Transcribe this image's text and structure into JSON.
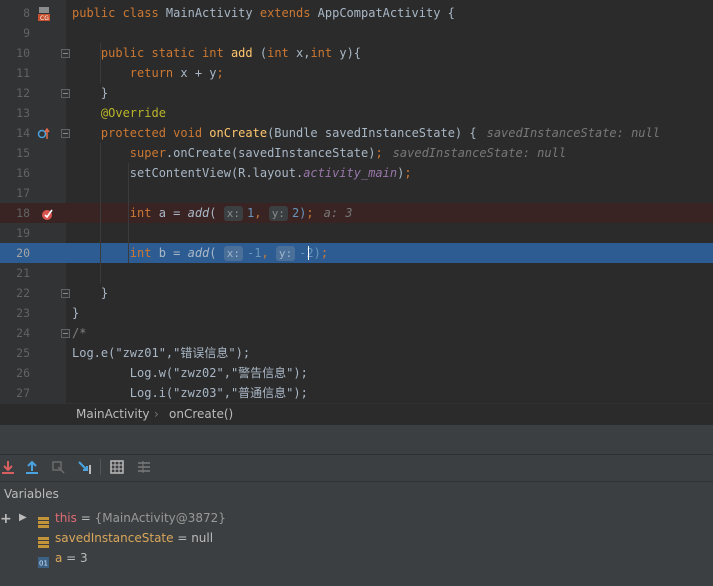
{
  "editor": {
    "lines": [
      {
        "num": "8",
        "tokens": [
          {
            "t": "public class ",
            "c": "kw"
          },
          {
            "t": "MainActivity ",
            "c": ""
          },
          {
            "t": "extends ",
            "c": "kw"
          },
          {
            "t": "AppCompatActivity {",
            "c": ""
          }
        ]
      },
      {
        "num": "9",
        "tokens": []
      },
      {
        "num": "10",
        "tokens": [
          {
            "t": "    public static int ",
            "c": "kw"
          },
          {
            "t": "add ",
            "c": "fn"
          },
          {
            "t": "(",
            "c": ""
          },
          {
            "t": "int ",
            "c": "kw"
          },
          {
            "t": "x,",
            "c": ""
          },
          {
            "t": "int ",
            "c": "kw"
          },
          {
            "t": "y){",
            "c": ""
          }
        ]
      },
      {
        "num": "11",
        "tokens": [
          {
            "t": "        return ",
            "c": "kw"
          },
          {
            "t": "x + y",
            "c": ""
          },
          {
            "t": ";",
            "c": "kw"
          }
        ]
      },
      {
        "num": "12",
        "tokens": [
          {
            "t": "    }",
            "c": ""
          }
        ]
      },
      {
        "num": "13",
        "tokens": [
          {
            "t": "    @Override",
            "c": "ann"
          }
        ]
      },
      {
        "num": "14",
        "tokens": [
          {
            "t": "    protected void ",
            "c": "kw"
          },
          {
            "t": "onCreate",
            "c": "fn"
          },
          {
            "t": "(Bundle savedInstanceState) {",
            "c": ""
          }
        ],
        "hint": "savedInstanceState: null"
      },
      {
        "num": "15",
        "tokens": [
          {
            "t": "        super",
            "c": "kw"
          },
          {
            "t": ".onCreate(savedInstanceState)",
            "c": ""
          },
          {
            "t": ";",
            "c": "kw"
          }
        ],
        "hint": "savedInstanceState: null"
      },
      {
        "num": "16",
        "tokens": [
          {
            "t": "        setContentView(R.layout.",
            "c": ""
          },
          {
            "t": "activity_main",
            "c": "fld"
          },
          {
            "t": ")",
            "c": ""
          },
          {
            "t": ";",
            "c": "kw"
          }
        ]
      },
      {
        "num": "17",
        "tokens": []
      },
      {
        "num": "18",
        "tokens": [
          {
            "t": "        int ",
            "c": "kw"
          },
          {
            "t": "a = ",
            "c": ""
          },
          {
            "t": "add",
            "c": "it"
          },
          {
            "t": "( ",
            "c": ""
          },
          {
            "t": "x:",
            "c": "ph"
          },
          {
            "t": "1",
            "c": "num"
          },
          {
            "t": ", ",
            "c": "kw"
          },
          {
            "t": "y:",
            "c": "ph"
          },
          {
            "t": "2)",
            "c": "num"
          },
          {
            "t": ";",
            "c": "kw"
          }
        ],
        "hint": "a: 3"
      },
      {
        "num": "19",
        "tokens": []
      },
      {
        "num": "20",
        "tokens": [
          {
            "t": "        int ",
            "c": "kw"
          },
          {
            "t": "b = ",
            "c": ""
          },
          {
            "t": "add",
            "c": "it"
          },
          {
            "t": "( ",
            "c": ""
          },
          {
            "t": "x:",
            "c": "ph"
          },
          {
            "t": "-1",
            "c": "num"
          },
          {
            "t": ", ",
            "c": "kw"
          },
          {
            "t": "y:",
            "c": "ph"
          },
          {
            "t": "-2)",
            "c": "num"
          },
          {
            "t": ";",
            "c": "kw"
          }
        ]
      },
      {
        "num": "21",
        "tokens": []
      },
      {
        "num": "22",
        "tokens": [
          {
            "t": "    }",
            "c": ""
          }
        ]
      },
      {
        "num": "23",
        "tokens": [
          {
            "t": "}",
            "c": ""
          }
        ]
      },
      {
        "num": "24",
        "tokens": [
          {
            "t": "/*",
            "c": "cmt"
          }
        ]
      },
      {
        "num": "25",
        "tokens": [
          {
            "t": "Log.e(\"zwz01\",\"错误信息\");",
            "c": ""
          }
        ]
      },
      {
        "num": "26",
        "tokens": [
          {
            "t": "        Log.w(\"zwz02\",\"警告信息\");",
            "c": ""
          }
        ]
      },
      {
        "num": "27",
        "tokens": [
          {
            "t": "        Log.i(\"zwz03\",\"普通信息\");",
            "c": ""
          }
        ]
      }
    ]
  },
  "breadcrumb": {
    "class_name": "MainActivity",
    "separator": "›",
    "method_name": "onCreate()"
  },
  "variables_panel": {
    "title": "Variables",
    "add_symbol": "+",
    "items": [
      {
        "name": "this",
        "eq": " = ",
        "value": "{MainActivity@3872}",
        "expandable": true
      },
      {
        "name": "savedInstanceState",
        "eq": " = ",
        "value": "null",
        "expandable": false
      },
      {
        "name": "a",
        "eq": " = ",
        "value": "3",
        "expandable": false
      }
    ]
  },
  "colors": {
    "background": "#2b2b2b",
    "breakpoint_line": "#3a2323",
    "execution_line": "#2d5c93",
    "panel": "#3c3f41"
  },
  "icons": [
    "class-icon",
    "override-icon",
    "breakpoint-icon",
    "step-over-icon",
    "step-into-icon",
    "force-step-into-icon",
    "step-out-icon",
    "run-to-cursor-icon",
    "evaluate-icon",
    "trace-icon",
    "expand-arrow-icon",
    "field-icon",
    "primitive-icon"
  ]
}
